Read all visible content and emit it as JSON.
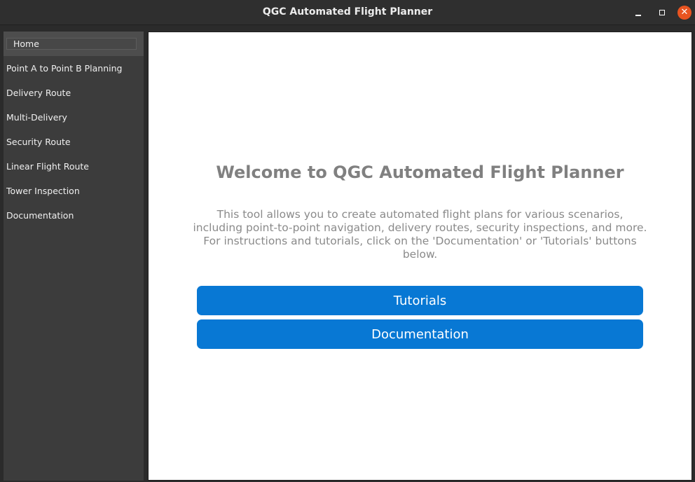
{
  "window": {
    "title": "QGC Automated Flight Planner",
    "controls": {
      "minimize_icon": "window-minimize-icon",
      "maximize_icon": "window-maximize-icon",
      "close_icon": "window-close-icon",
      "close_glyph": "✕",
      "close_color": "#e95420"
    }
  },
  "sidebar": {
    "items": [
      {
        "label": "Home",
        "active": true
      },
      {
        "label": "Point A to Point B Planning"
      },
      {
        "label": "Delivery Route"
      },
      {
        "label": "Multi-Delivery"
      },
      {
        "label": "Security Route"
      },
      {
        "label": "Linear Flight Route"
      },
      {
        "label": "Tower Inspection"
      },
      {
        "label": "Documentation"
      }
    ]
  },
  "main": {
    "heading": "Welcome to QGC Automated Flight Planner",
    "description": "This tool allows you to create automated flight plans for various scenarios, including point-to-point navigation, delivery routes, security inspections, and more. For instructions and tutorials, click on the 'Documentation' or 'Tutorials' buttons below.",
    "buttons": {
      "tutorials": "Tutorials",
      "documentation": "Documentation"
    },
    "accent_color": "#0878d4"
  }
}
